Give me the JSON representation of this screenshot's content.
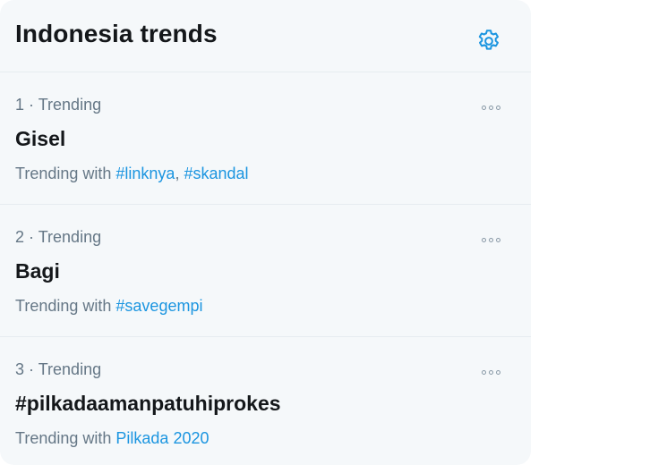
{
  "header": {
    "title": "Indonesia trends",
    "settings_icon": "gear-icon"
  },
  "colors": {
    "accent": "#1b95e0",
    "panel_bg": "#f5f8fa",
    "text_primary": "#14171a",
    "text_secondary": "#657786"
  },
  "trends": [
    {
      "rank": "1",
      "separator": "·",
      "category": "Trending",
      "name": "Gisel",
      "trending_with_label": "Trending with",
      "hashtags": [
        "#linknya",
        "#skandal"
      ]
    },
    {
      "rank": "2",
      "separator": "·",
      "category": "Trending",
      "name": "Bagi",
      "trending_with_label": "Trending with",
      "hashtags": [
        "#savegempi"
      ]
    },
    {
      "rank": "3",
      "separator": "·",
      "category": "Trending",
      "name": "#pilkadaamanpatuhiprokes",
      "trending_with_label": "Trending with",
      "hashtags": [
        "Pilkada 2020"
      ]
    }
  ]
}
